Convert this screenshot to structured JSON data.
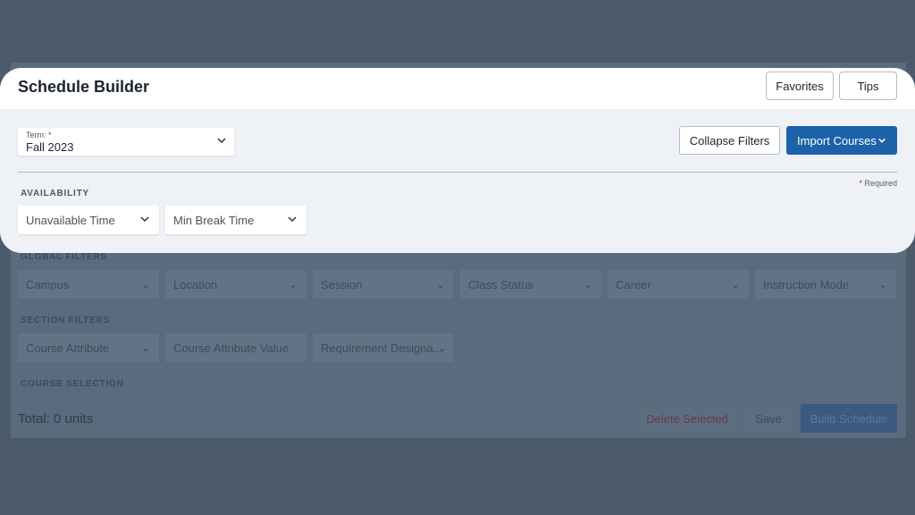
{
  "app": {
    "title": "Schedule Builder"
  },
  "header": {
    "favorites_label": "Favorites",
    "tips_label": "Tips"
  },
  "term": {
    "label": "Term:",
    "required_mark": "*",
    "value": "Fall 2023"
  },
  "toolbar": {
    "collapse_label": "Collapse Filters",
    "import_label": "Import Courses"
  },
  "required_note": {
    "mark": "*",
    "text": "Required"
  },
  "availability": {
    "heading": "AVAILABILITY",
    "selects": [
      "Unavailable Time",
      "Min Break Time"
    ]
  },
  "global_filters": {
    "heading": "GLOBAL FILTERS",
    "selects": [
      "Campus",
      "Location",
      "Session",
      "Class Status",
      "Career",
      "Instruction Mode"
    ]
  },
  "section_filters": {
    "heading": "SECTION FILTERS",
    "selects": [
      "Course Attribute",
      "Course Attribute Value",
      "Requirement Designa..."
    ]
  },
  "course_selection": {
    "heading": "COURSE SELECTION"
  },
  "footer": {
    "total": "Total: 0 units",
    "delete_label": "Delete Selected",
    "save_label": "Save",
    "build_label": "Build Schedule"
  },
  "colors": {
    "accent": "#1c62a8",
    "overlay": "#4b5b6c",
    "required": "#c0282d"
  }
}
